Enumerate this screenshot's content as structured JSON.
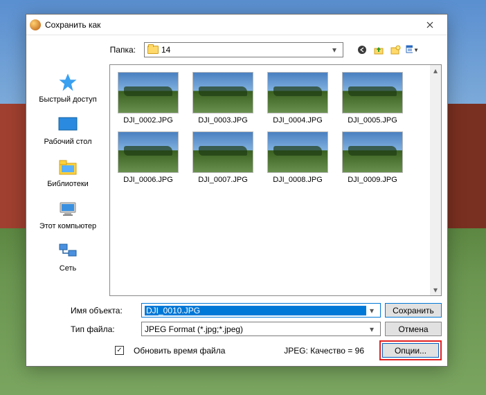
{
  "dialog": {
    "title": "Сохранить как",
    "folder_label": "Папка:",
    "folder_value": "14",
    "places": [
      {
        "id": "quick",
        "label": "Быстрый доступ"
      },
      {
        "id": "desktop",
        "label": "Рабочий стол"
      },
      {
        "id": "libs",
        "label": "Библиотеки"
      },
      {
        "id": "pc",
        "label": "Этот компьютер"
      },
      {
        "id": "net",
        "label": "Сеть"
      }
    ],
    "files": [
      {
        "name": "DJI_0002.JPG"
      },
      {
        "name": "DJI_0003.JPG"
      },
      {
        "name": "DJI_0004.JPG"
      },
      {
        "name": "DJI_0005.JPG"
      },
      {
        "name": "DJI_0006.JPG"
      },
      {
        "name": "DJI_0007.JPG"
      },
      {
        "name": "DJI_0008.JPG"
      },
      {
        "name": "DJI_0009.JPG"
      }
    ],
    "filename_label": "Имя объекта:",
    "filename_value": "DJI_0010.JPG",
    "filetype_label": "Тип файла:",
    "filetype_value": "JPEG Format (*.jpg;*.jpeg)",
    "save_label": "Сохранить",
    "cancel_label": "Отмена",
    "options_label": "Опции...",
    "checkbox_label": "Обновить время файла",
    "quality_label": "JPEG: Качество = 96"
  }
}
